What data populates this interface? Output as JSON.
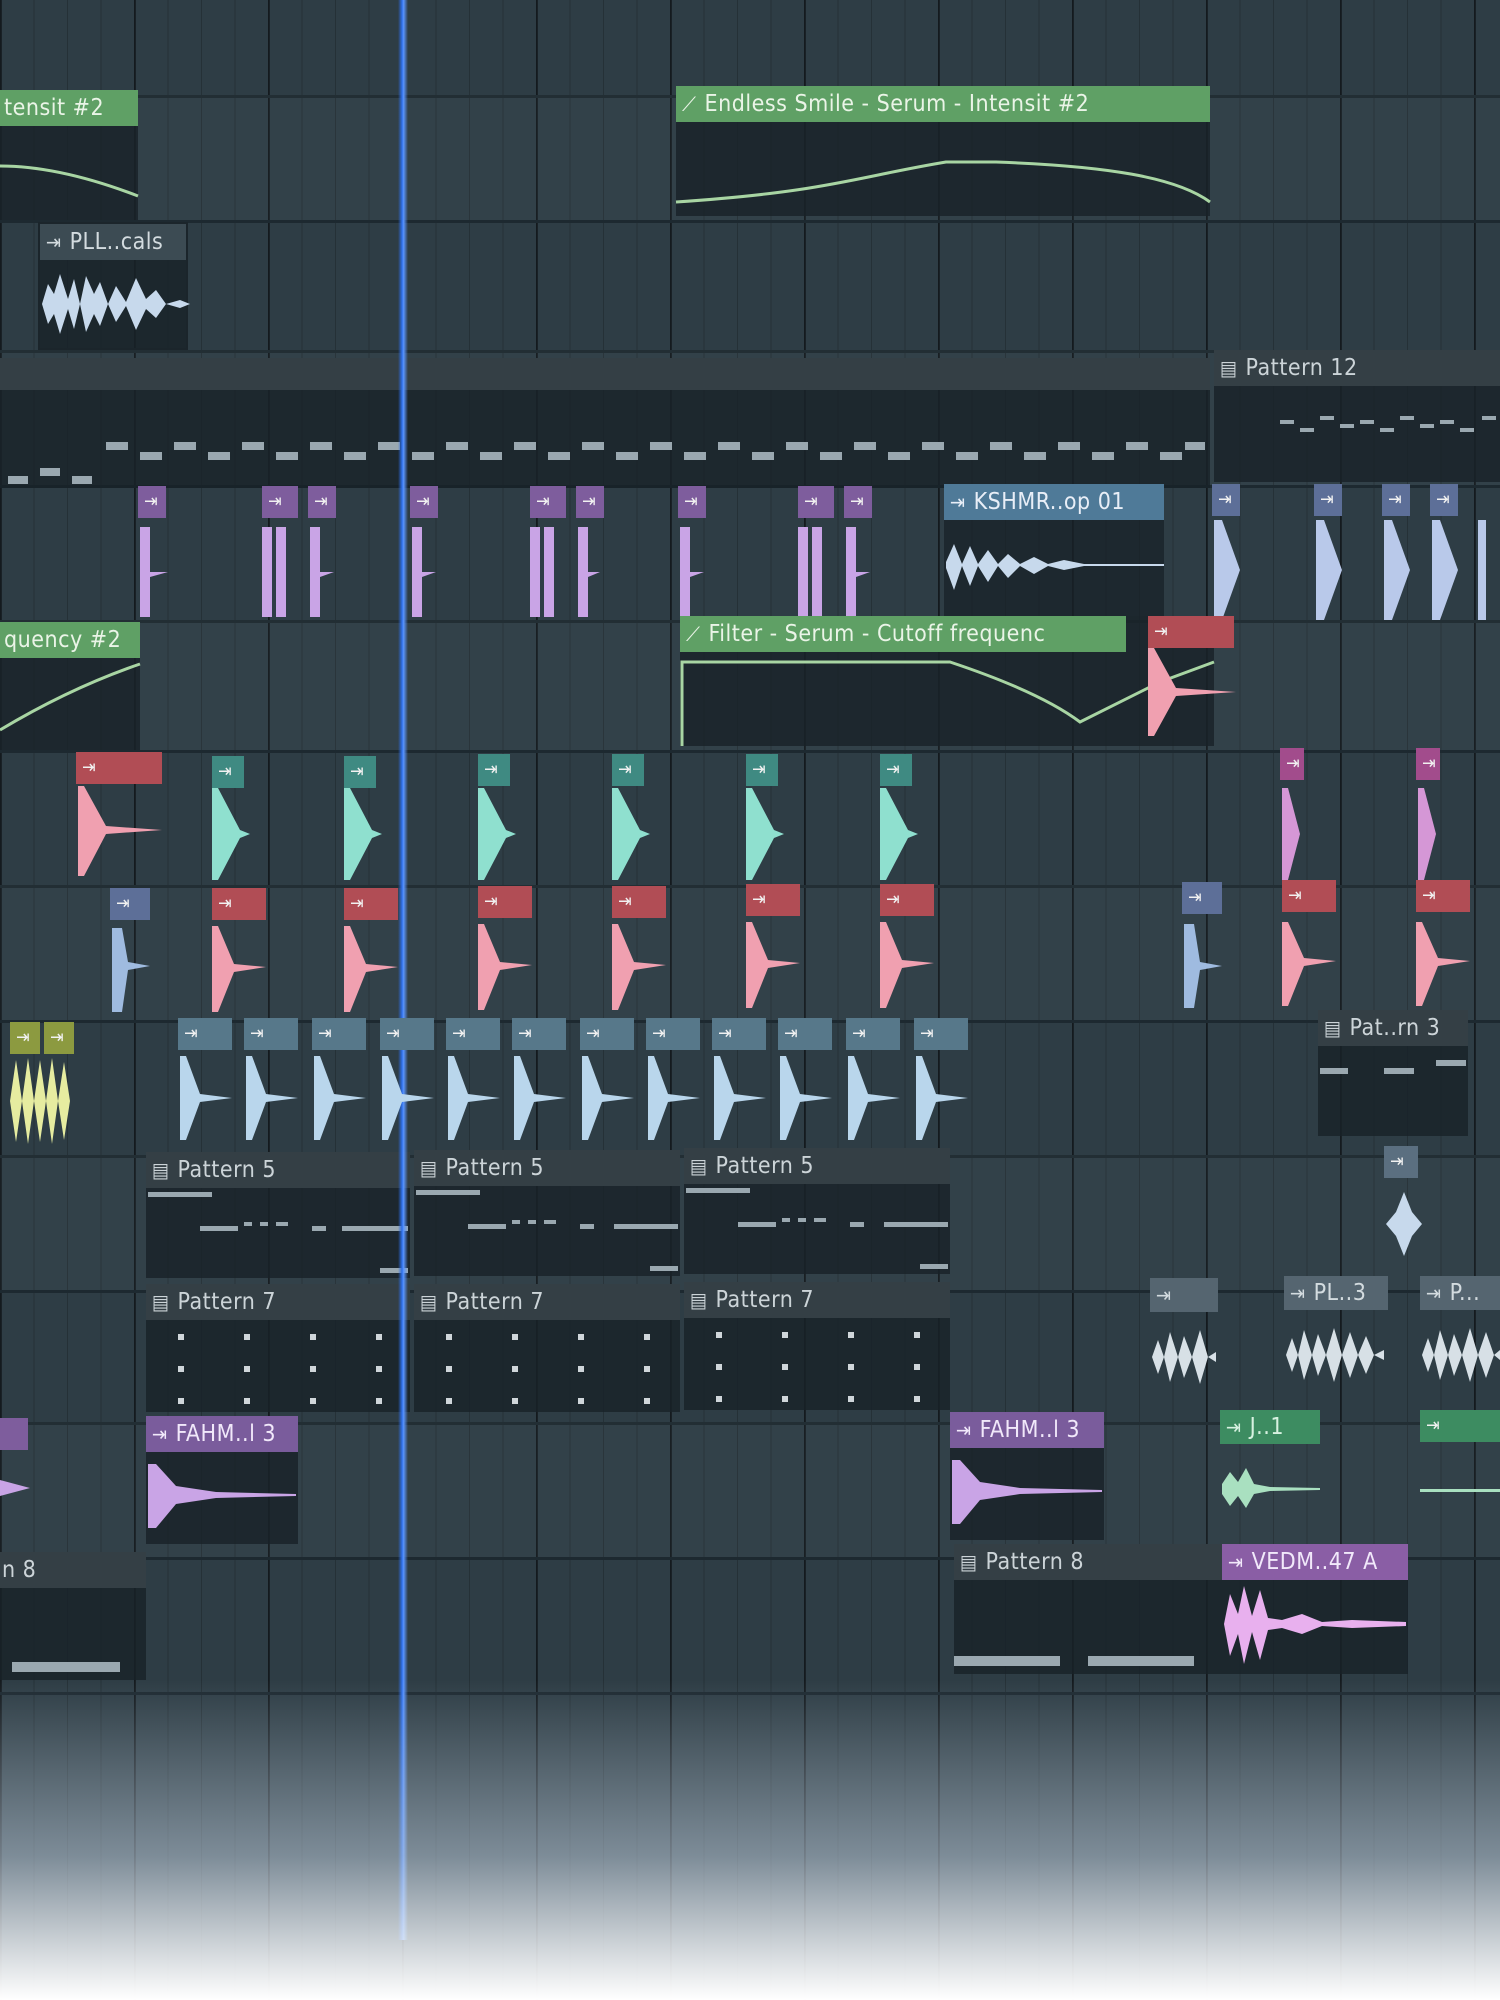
{
  "app": "playlist",
  "colors": {
    "automation": "#5fa065",
    "playhead": "#2d6ee8",
    "sample_purple": "#c9a4e6",
    "sample_teal": "#8fe0cf",
    "sample_pink": "#f0a0b0",
    "sample_blue": "#c7d9ec",
    "sample_yellow": "#e6eca0"
  },
  "clips": {
    "automation_intensit_left": "tensit #2",
    "automation_endless_smile": "Endless Smile - Serum - Intensit #2",
    "audio_pll_cals": "PLL..cals",
    "pattern_12": "Pattern 12",
    "audio_kshmr": "KSHMR..op 01",
    "automation_frequency_left": "quency #2",
    "automation_filter": "Filter - Serum - Cutoff frequenc",
    "pattern_3": "Pat..rn 3",
    "pattern_5": [
      "Pattern 5",
      "Pattern 5",
      "Pattern 5"
    ],
    "pattern_7": [
      "Pattern 7",
      "Pattern 7",
      "Pattern 7"
    ],
    "audio_pl3": "PL..3",
    "audio_p": "P...",
    "audio_fahm_left": "FAHM..l 3",
    "audio_fahm_right": "FAHM..l 3",
    "audio_j1": "J..1",
    "pattern_8_left": "n 8",
    "pattern_8": "Pattern 8",
    "audio_vedm": "VEDM..47 A"
  },
  "icons": {
    "audio": "audio-clip-icon",
    "pattern": "pattern-clip-icon",
    "automation": "automation-clip-icon"
  }
}
